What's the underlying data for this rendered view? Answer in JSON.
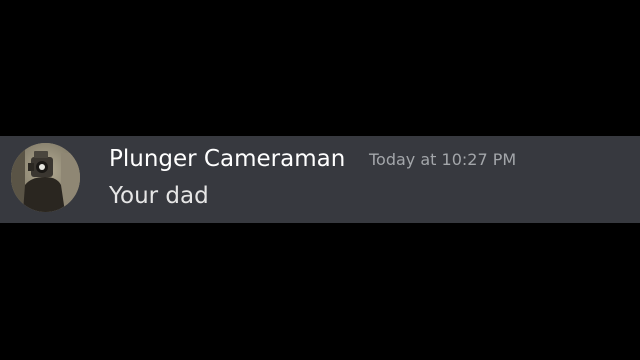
{
  "theme": {
    "background": "#000000",
    "message_background": "#37393f",
    "username_color": "#ffffff",
    "timestamp_color": "#a3a6aa",
    "text_color": "#e6e6e6"
  },
  "message": {
    "avatar_icon": "user-avatar",
    "username": "Plunger Cameraman",
    "timestamp": "Today at 10:27 PM",
    "content": "Your dad"
  }
}
